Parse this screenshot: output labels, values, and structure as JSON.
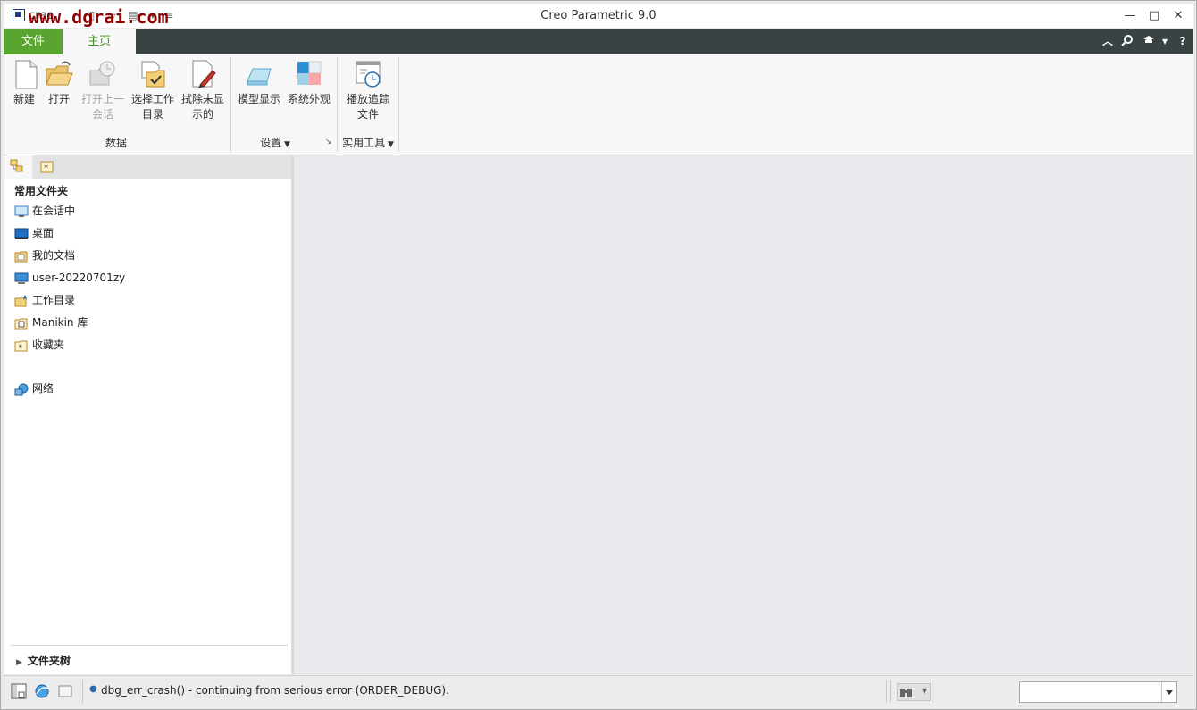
{
  "window": {
    "app_short_name": "creo",
    "title": "Creo Parametric 9.0",
    "watermark": "www.dgrai.com",
    "controls": {
      "minimize": "—",
      "maximize": "□",
      "close": "✕"
    }
  },
  "ribbon_tabs": {
    "file": "文件",
    "home": "主页",
    "right_icons": [
      "collapse-ribbon-icon",
      "search-icon",
      "learning-icon",
      "dropdown-icon",
      "help-icon"
    ],
    "help_label": "?"
  },
  "ribbon": {
    "groups": [
      {
        "label": "数据",
        "buttons": [
          {
            "label": "新建",
            "enabled": true
          },
          {
            "label": "打开",
            "enabled": true
          },
          {
            "label": "打开上一会话",
            "line1": "打开上一",
            "line2": "会话",
            "enabled": false
          },
          {
            "label": "选择工作目录",
            "line1": "选择工作",
            "line2": "目录",
            "enabled": true
          },
          {
            "label": "拭除未显示的",
            "line1": "拭除未显",
            "line2": "示的",
            "enabled": true
          }
        ]
      },
      {
        "label": "设置",
        "buttons": [
          {
            "label": "模型显示",
            "enabled": true
          },
          {
            "label": "系统外观",
            "enabled": true
          }
        ]
      },
      {
        "label": "实用工具",
        "buttons": [
          {
            "label": "播放追踪文件",
            "line1": "播放追踪",
            "line2": "文件",
            "enabled": true
          }
        ]
      }
    ]
  },
  "folder_panel": {
    "header": "常用文件夹",
    "items": [
      {
        "label": "在会话中",
        "icon": "in-session-icon"
      },
      {
        "label": "桌面",
        "icon": "desktop-icon"
      },
      {
        "label": "我的文档",
        "icon": "my-documents-icon"
      },
      {
        "label": "user-20220701zy",
        "icon": "computer-icon"
      },
      {
        "label": "工作目录",
        "icon": "working-directory-icon"
      },
      {
        "label": "Manikin 库",
        "icon": "manikin-library-icon"
      },
      {
        "label": "收藏夹",
        "icon": "favorites-icon"
      },
      {
        "label": "网络",
        "icon": "network-icon"
      }
    ],
    "tree_label": "文件夹树"
  },
  "status_bar": {
    "message": "dbg_err_crash() - continuing from serious error (ORDER_DEBUG).",
    "filter_value": ""
  },
  "colors": {
    "file_tab": "#5aa532",
    "tab_bar": "#3a4344",
    "home_tab_text": "#3d8f1f",
    "work_area": "#e8e9ec",
    "watermark": "#8b0000"
  }
}
